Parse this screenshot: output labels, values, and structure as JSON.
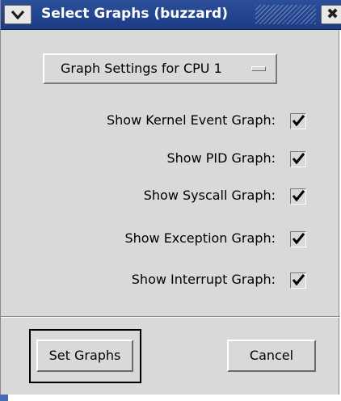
{
  "window": {
    "title": "Select Graphs (buzzard)",
    "menu_icon": "chevron-down-icon",
    "close_glyph": "✖"
  },
  "option_menu": {
    "selected": "Graph Settings for CPU 1"
  },
  "options": [
    {
      "label": "Show Kernel Event Graph:",
      "checked": true
    },
    {
      "label": "Show PID Graph:",
      "checked": true
    },
    {
      "label": "Show Syscall Graph:",
      "checked": true
    },
    {
      "label": "Show Exception Graph:",
      "checked": true
    },
    {
      "label": "Show Interrupt Graph:",
      "checked": true
    }
  ],
  "buttons": {
    "set_graphs": "Set Graphs",
    "cancel": "Cancel"
  },
  "colors": {
    "titlebar": "#1c3c85",
    "dialog_bg": "#d9d9d9"
  }
}
